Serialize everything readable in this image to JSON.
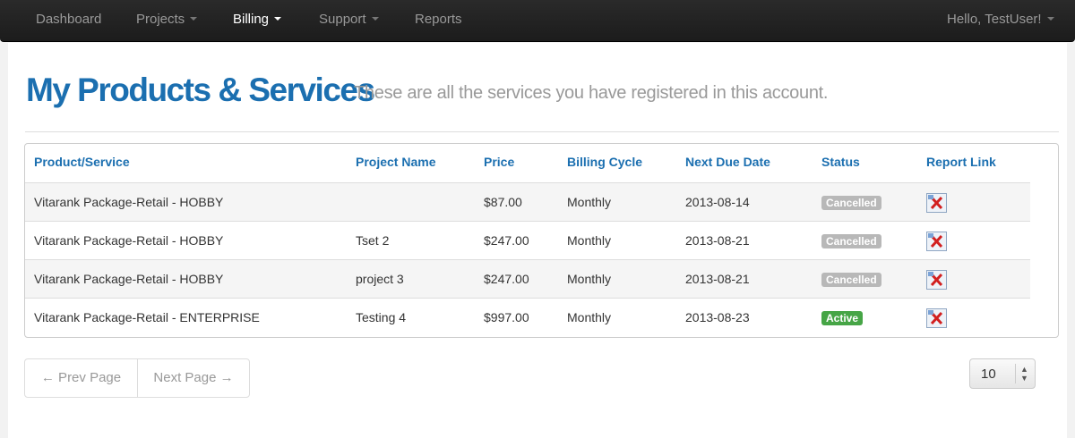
{
  "nav": {
    "items": [
      {
        "label": "Dashboard",
        "dropdown": false,
        "active": false
      },
      {
        "label": "Projects",
        "dropdown": true,
        "active": false
      },
      {
        "label": "Billing",
        "dropdown": true,
        "active": true
      },
      {
        "label": "Support",
        "dropdown": true,
        "active": false
      },
      {
        "label": "Reports",
        "dropdown": false,
        "active": false
      }
    ],
    "user_greeting": "Hello, TestUser!"
  },
  "page": {
    "title": "My Products & Services",
    "subtitle": "These are all the services you have registered in this account."
  },
  "table": {
    "headers": [
      "Product/Service",
      "Project Name",
      "Price",
      "Billing Cycle",
      "Next Due Date",
      "Status",
      "Report Link"
    ],
    "rows": [
      {
        "product": "Vitarank Package-Retail - HOBBY",
        "project": "",
        "price": "$87.00",
        "cycle": "Monthly",
        "due": "2013-08-14",
        "status": "Cancelled"
      },
      {
        "product": "Vitarank Package-Retail - HOBBY",
        "project": "Tset 2",
        "price": "$247.00",
        "cycle": "Monthly",
        "due": "2013-08-21",
        "status": "Cancelled"
      },
      {
        "product": "Vitarank Package-Retail - HOBBY",
        "project": "project 3",
        "price": "$247.00",
        "cycle": "Monthly",
        "due": "2013-08-21",
        "status": "Cancelled"
      },
      {
        "product": "Vitarank Package-Retail - ENTERPRISE",
        "project": "Testing 4",
        "price": "$997.00",
        "cycle": "Monthly",
        "due": "2013-08-23",
        "status": "Active"
      }
    ],
    "report_icon": "broken-image-icon"
  },
  "pagination": {
    "prev_label": "← Prev Page",
    "next_label": "Next Page →"
  },
  "page_size": {
    "selected": "10"
  },
  "colors": {
    "accent": "#1b6fb0",
    "navbar": "#1c1c1c",
    "status_active": "#46a546",
    "status_cancelled": "#b8b8b8"
  }
}
